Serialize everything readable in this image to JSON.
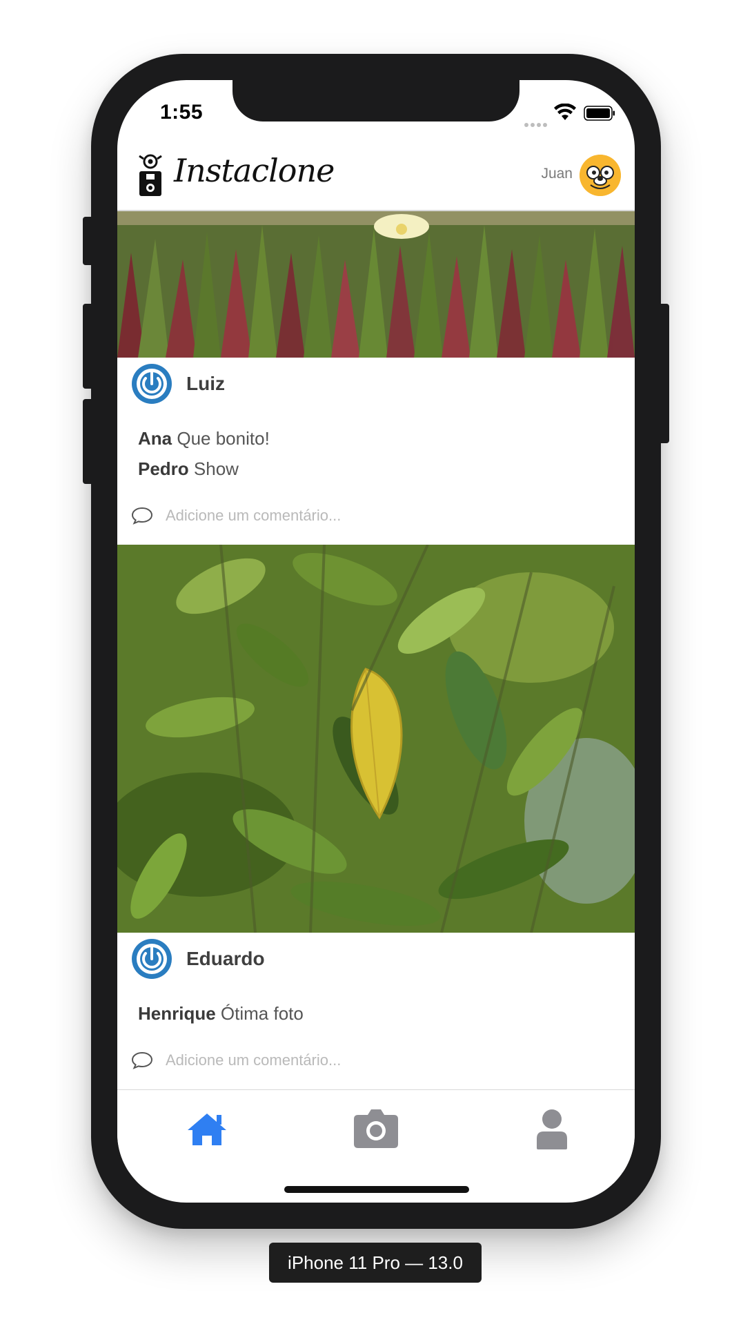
{
  "status_bar": {
    "time": "1:55"
  },
  "header": {
    "app_name": "Instaclone",
    "user_name": "Juan"
  },
  "posts": [
    {
      "author": "Luiz",
      "comments": [
        {
          "author": "Ana",
          "text": "Que bonito!"
        },
        {
          "author": "Pedro",
          "text": "Show"
        }
      ],
      "comment_placeholder": "Adicione um comentário..."
    },
    {
      "author": "Eduardo",
      "comments": [
        {
          "author": "Henrique",
          "text": "Ótima foto"
        }
      ],
      "comment_placeholder": "Adicione um comentário..."
    }
  ],
  "tab_bar": {
    "tabs": [
      {
        "icon": "home-icon",
        "active": true
      },
      {
        "icon": "camera-icon",
        "active": false
      },
      {
        "icon": "user-icon",
        "active": false
      }
    ],
    "active_color": "#2f7ff2",
    "inactive_color": "#8e8e93"
  },
  "device_label": "iPhone 11 Pro — 13.0"
}
